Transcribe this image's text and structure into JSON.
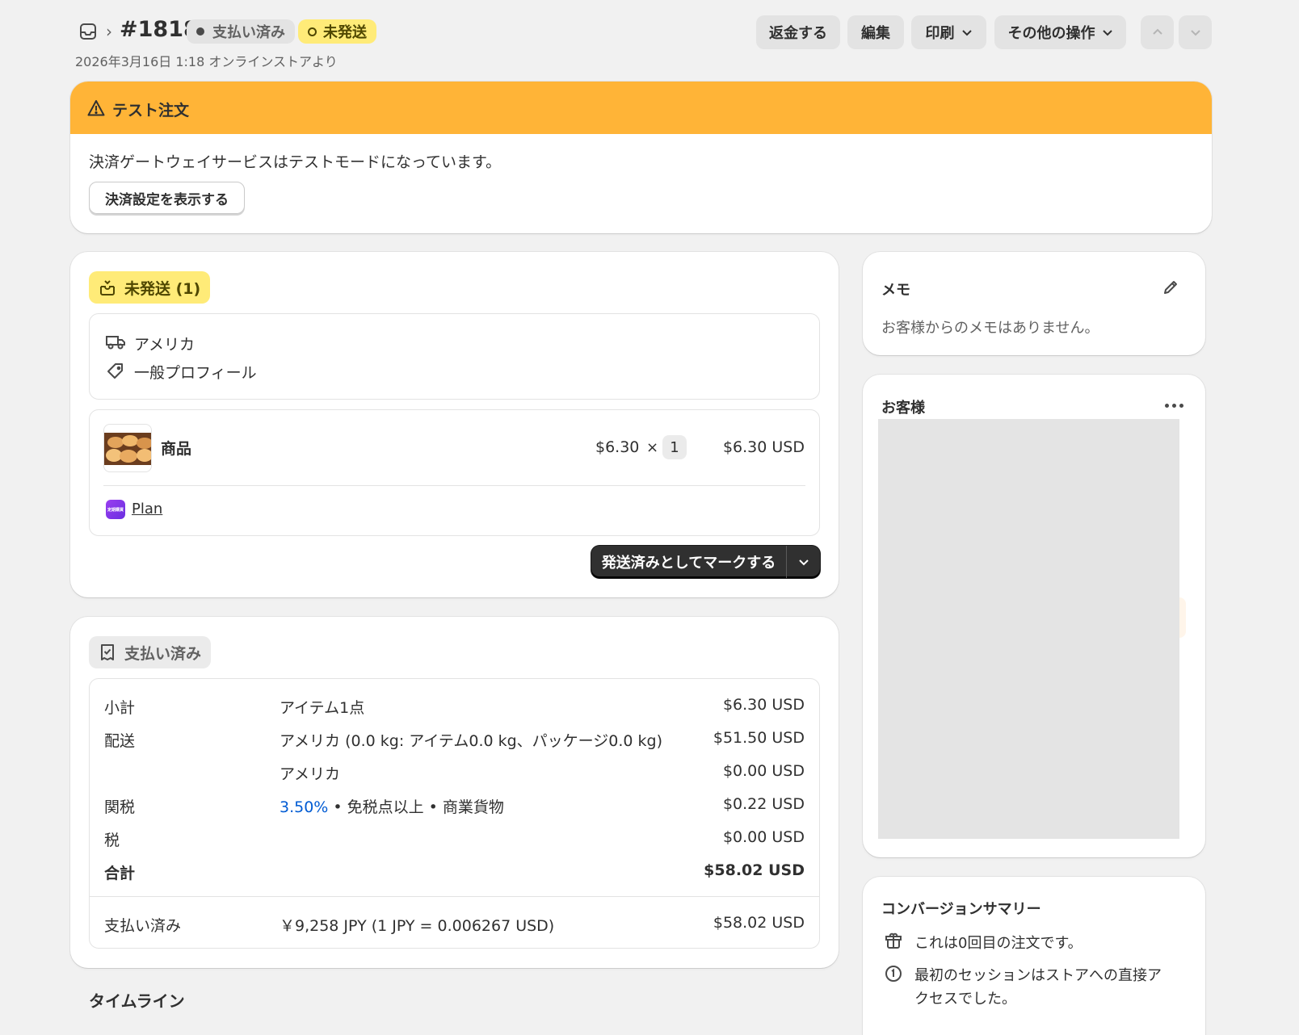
{
  "header": {
    "order_number": "#1818",
    "paid_badge": "支払い済み",
    "unfulfilled_badge": "未発送",
    "subtitle": "2026年3月16日 1:18 オンラインストアより",
    "refund_button": "返金する",
    "edit_button": "編集",
    "print_button": "印刷",
    "more_actions_button": "その他の操作"
  },
  "test_banner": {
    "title": "テスト注文",
    "message": "決済ゲートウェイサービスはテストモードになっています。",
    "button": "決済設定を表示する"
  },
  "fulfillment": {
    "badge": "未発送 (1)",
    "shipping_zone": "アメリカ",
    "profile": "一般プロフィール",
    "item_name": "商品",
    "unit_price": "$6.30",
    "times": "×",
    "quantity": "1",
    "line_total": "$6.30 USD",
    "plan_link": "Plan",
    "app_icon_text": "定期購買",
    "mark_button": "発送済みとしてマークする"
  },
  "payment": {
    "badge": "支払い済み",
    "rows": [
      {
        "label": "小計",
        "desc": "アイテム1点",
        "amount": "$6.30 USD"
      },
      {
        "label": "配送",
        "desc": "アメリカ (0.0 kg: アイテム0.0 kg、パッケージ0.0 kg)",
        "amount": "$51.50 USD"
      },
      {
        "label": "",
        "desc": "アメリカ",
        "amount": "$0.00 USD"
      },
      {
        "label": "関税",
        "desc_link": "3.50%",
        "desc": " • 免税点以上 • 商業貨物",
        "amount": "$0.22 USD"
      },
      {
        "label": "税",
        "desc": "",
        "amount": "$0.00 USD"
      },
      {
        "label": "合計",
        "desc": "",
        "amount": "$58.02 USD"
      }
    ],
    "paid_label": "支払い済み",
    "paid_desc": "￥9,258 JPY (1 JPY = 0.006267 USD)",
    "paid_amount": "$58.02 USD"
  },
  "timeline": {
    "title": "タイムライン"
  },
  "memo": {
    "title": "メモ",
    "text": "お客様からのメモはありません。"
  },
  "customer": {
    "title": "お客様"
  },
  "conversion": {
    "title": "コンバージョンサマリー",
    "line1": "これは0回目の注文です。",
    "line2a": "最初のセッションはストアへの直接ア",
    "line2b": "クセスでした。"
  },
  "colors": {
    "warning": "#ffb437",
    "badge_yellow": "#ffeb78",
    "link_blue": "#005bd3"
  }
}
